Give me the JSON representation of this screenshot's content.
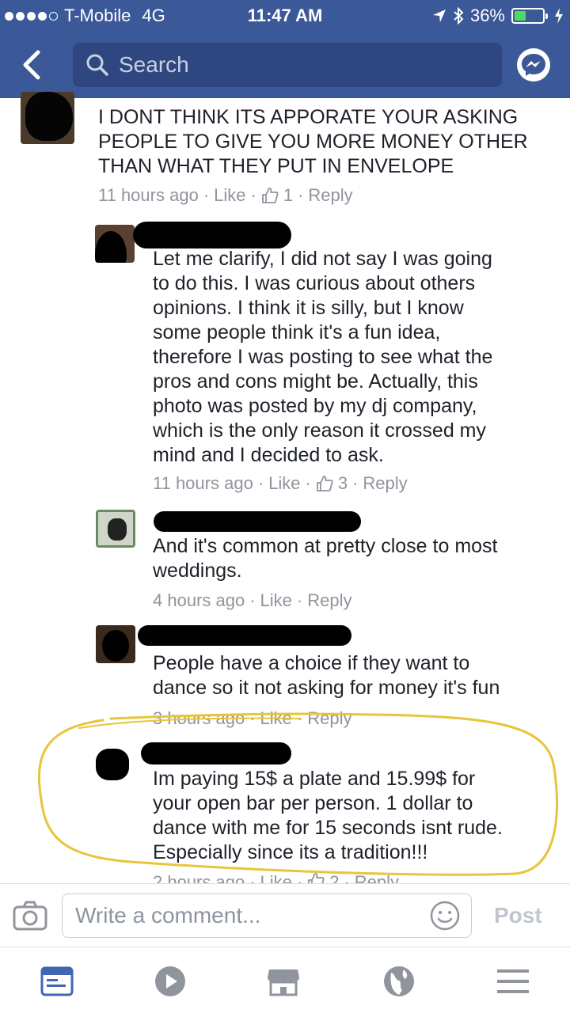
{
  "status_bar": {
    "carrier": "T-Mobile",
    "network": "4G",
    "time": "11:47 AM",
    "battery": "36%",
    "battery_level": 0.36
  },
  "header": {
    "search_placeholder": "Search"
  },
  "comments": [
    {
      "text": "I DONT THINK ITS APPORATE YOUR ASKING\nPEOPLE TO GIVE YOU MORE MONEY OTHER\nTHAN WHAT THEY PUT IN ENVELOPE",
      "time": "11 hours ago",
      "like": "Like",
      "likes": "1",
      "reply": "Reply"
    },
    {
      "text": "Let me clarify, I did not say I was going\nto do this. I was curious about others\nopinions. I think it is silly, but I know\nsome people think it's a fun idea,\ntherefore I was posting to see what the\npros and cons might be. Actually, this\nphoto was posted by my dj company,\nwhich is the only reason it crossed my\nmind and I decided to ask.",
      "time": "11 hours ago",
      "like": "Like",
      "likes": "3",
      "reply": "Reply"
    },
    {
      "text": "And it's common at pretty close to most\nweddings.",
      "time": "4 hours ago",
      "like": "Like",
      "reply": "Reply"
    },
    {
      "text": "People have a choice if they want to\ndance so it not asking for money it's fun",
      "time": "3 hours ago",
      "like": "Like",
      "reply": "Reply"
    },
    {
      "text": "Im paying 15$ a plate and 15.99$ for\nyour open bar per person. 1 dollar to\ndance with me for 15 seconds isnt rude.\nEspecially since its a tradition!!!",
      "time": "2 hours ago",
      "like": "Like",
      "likes": "2",
      "reply": "Reply"
    }
  ],
  "composer": {
    "placeholder": "Write a comment...",
    "post_label": "Post"
  },
  "tabs": [
    "news-feed-icon",
    "video-icon",
    "marketplace-icon",
    "globe-icon",
    "menu-icon"
  ],
  "colors": {
    "brand": "#3b5998",
    "highlight": "#e8c53a"
  }
}
